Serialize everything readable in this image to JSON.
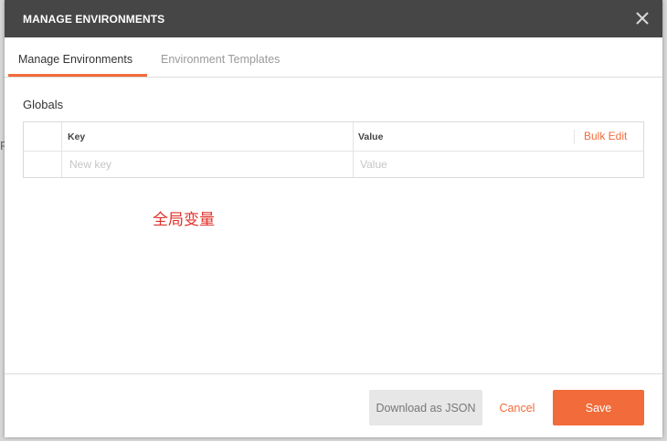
{
  "background": {
    "edge_letter": "F"
  },
  "modal": {
    "title": "MANAGE ENVIRONMENTS",
    "close_icon": "close-icon"
  },
  "tabs": [
    {
      "label": "Manage Environments",
      "active": true
    },
    {
      "label": "Environment Templates",
      "active": false
    }
  ],
  "globals": {
    "title": "Globals",
    "columns": {
      "key": "Key",
      "value": "Value"
    },
    "bulk_edit_label": "Bulk Edit",
    "new_row": {
      "key_placeholder": "New key",
      "value_placeholder": "Value",
      "key_value": "",
      "value_value": ""
    }
  },
  "annotation": "全局变量",
  "footer": {
    "download_label": "Download as JSON",
    "cancel_label": "Cancel",
    "save_label": "Save"
  },
  "colors": {
    "accent": "#f26b3a",
    "header_bg": "#464646",
    "annotation": "#e0312a"
  }
}
